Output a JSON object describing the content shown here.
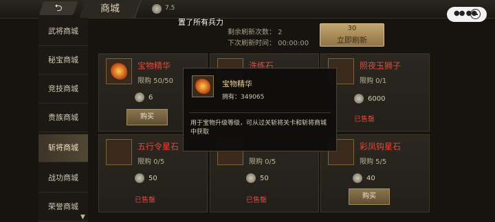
{
  "topbar": {
    "back_icon": "back-arrow-icon",
    "title": "商城",
    "currency_label": "7.5",
    "window_controls": {
      "menu_icon": "more-dots-icon",
      "minimize_icon": "minimize-icon"
    }
  },
  "sidebar": {
    "items": [
      {
        "label": "武将商城",
        "active": false
      },
      {
        "label": "秘宝商城",
        "active": false
      },
      {
        "label": "竞技商城",
        "active": false
      },
      {
        "label": "贵族商城",
        "active": false
      },
      {
        "label": "斩将商城",
        "active": true
      },
      {
        "label": "战功商城",
        "active": false
      },
      {
        "label": "荣誉商城",
        "active": false
      }
    ],
    "more_icon": "chevron-down-icon"
  },
  "banner": {
    "text": "置了所有兵力",
    "refresh_remaining": "剩余刷新次数：  2",
    "next_refresh": "下次刷新时间：  00:00:00",
    "refresh_button": {
      "cost": "30",
      "label": "立即刷新"
    }
  },
  "cards": [
    {
      "name": "宝物精华",
      "limit": "限购 50/50",
      "price": "6",
      "action": "购买",
      "sold": ""
    },
    {
      "name": "洗练石",
      "limit": "",
      "price": "",
      "action": "",
      "sold": ""
    },
    {
      "name": "照夜玉狮子",
      "limit": "限购 0/1",
      "price": "6000",
      "action": "",
      "sold": "已售罄"
    },
    {
      "name": "五行令星石",
      "limit": "限购 0/5",
      "price": "50",
      "action": "",
      "sold": "已售罄"
    },
    {
      "name": "",
      "limit": "限购 0/5",
      "price": "50",
      "action": "",
      "sold": "已售罄"
    },
    {
      "name": "彩凤钩星石",
      "limit": "限购 5/5",
      "price": "40",
      "action": "购买",
      "sold": ""
    }
  ],
  "popup": {
    "name": "宝物精华",
    "owned": "拥有：349065",
    "description": "用于宝物升级等级，可从过关斩将关卡和斩将商城中获取"
  }
}
